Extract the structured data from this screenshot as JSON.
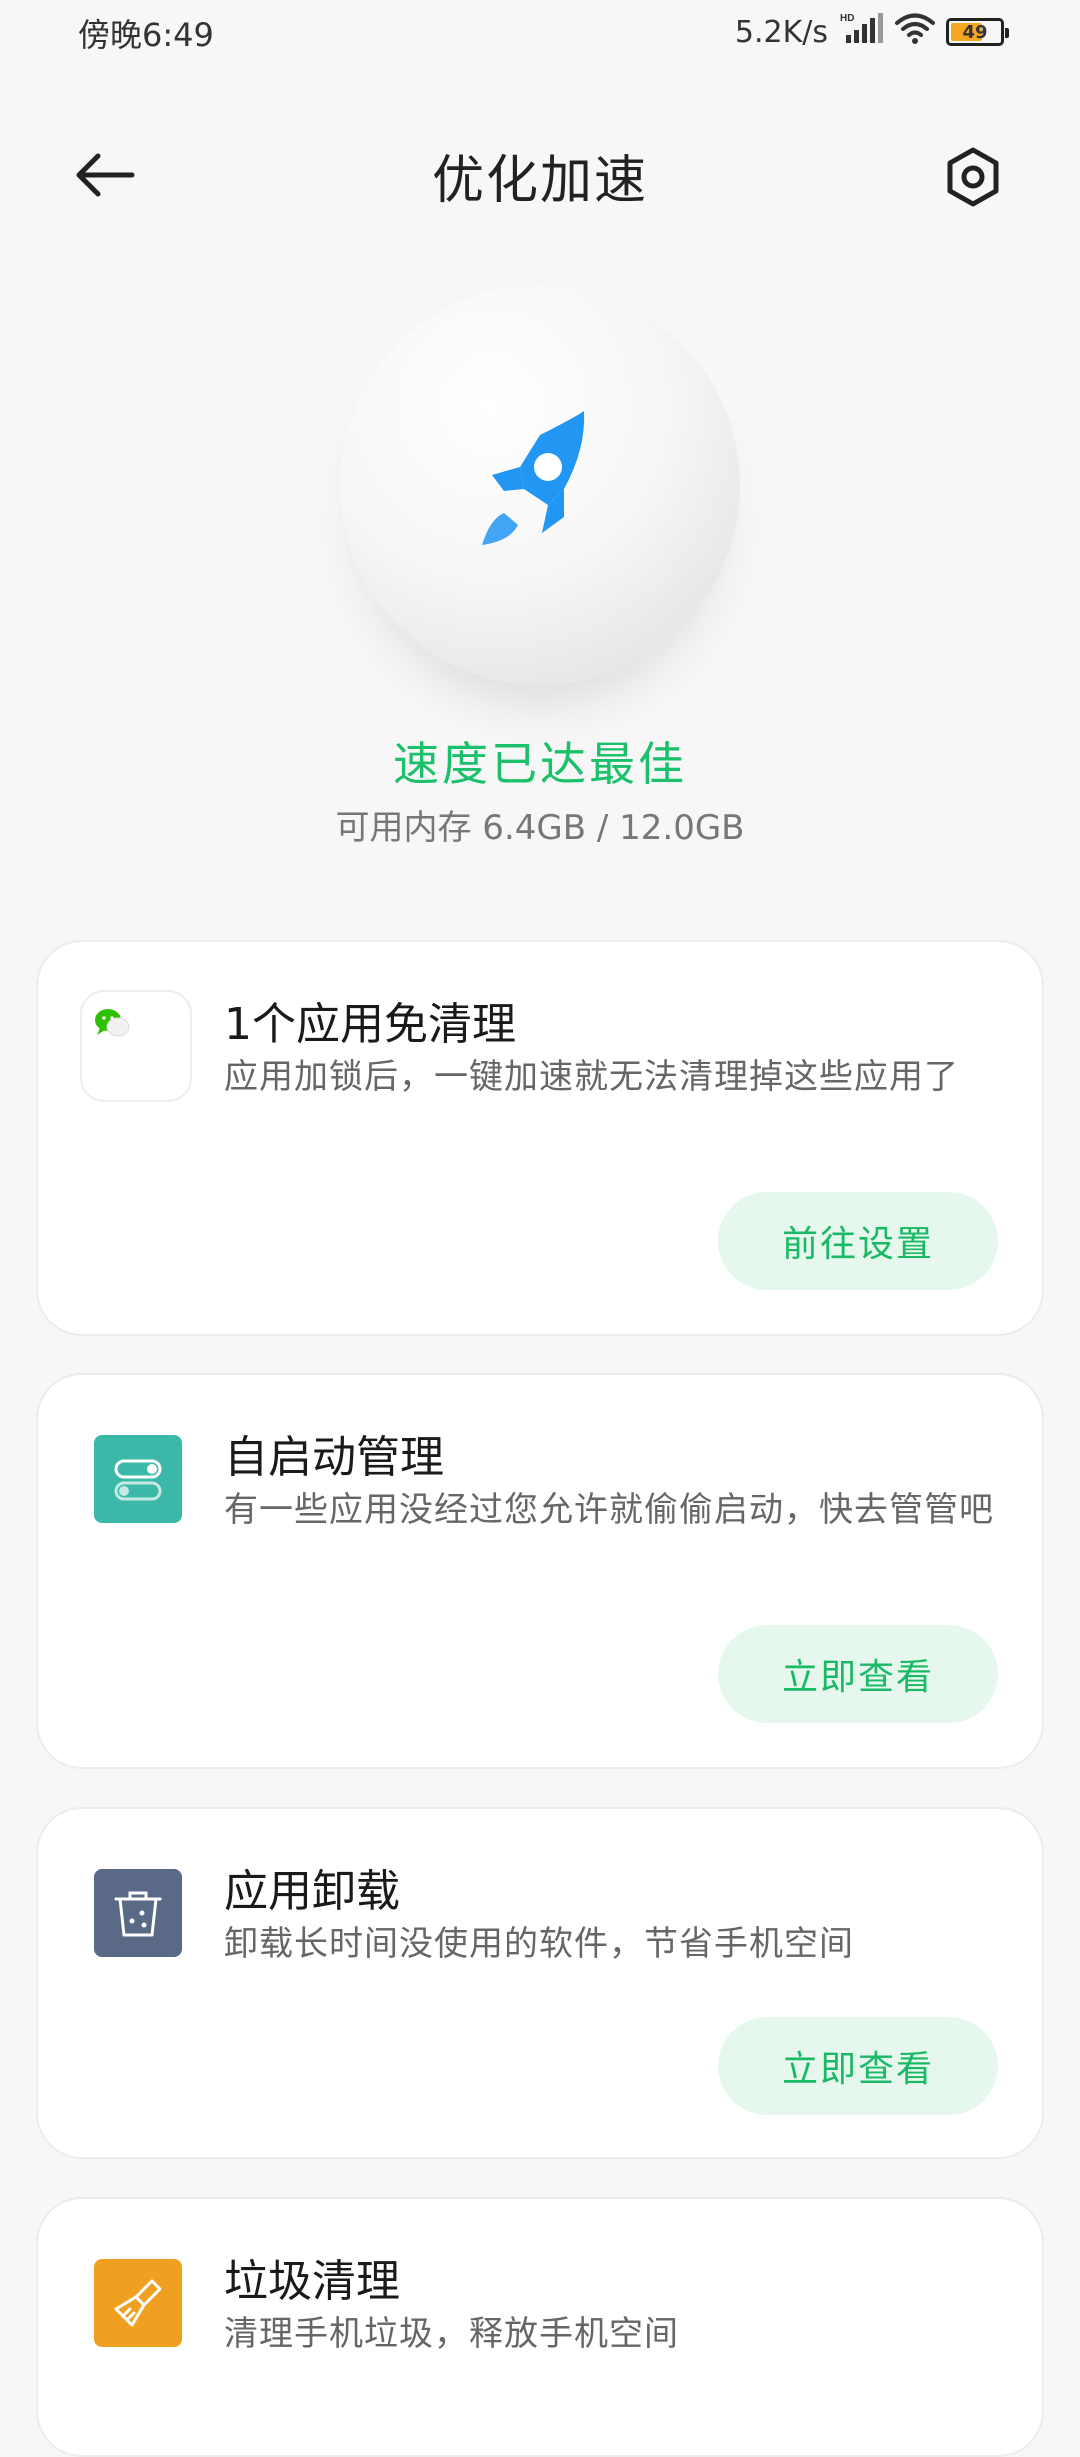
{
  "status_bar": {
    "time": "傍晚6:49",
    "net_speed": "5.2K/s",
    "battery_level": "49"
  },
  "header": {
    "title": "优化加速"
  },
  "hero": {
    "status": "速度已达最佳",
    "memory": "可用内存 6.4GB / 12.0GB"
  },
  "cards": [
    {
      "title": "1个应用免清理",
      "desc": "应用加锁后，一键加速就无法清理掉这些应用了",
      "button": "前往设置",
      "icon": "wechat-icon"
    },
    {
      "title": "自启动管理",
      "desc": "有一些应用没经过您允许就偷偷启动，快去管管吧",
      "button": "立即查看",
      "icon": "toggle-switch-icon"
    },
    {
      "title": "应用卸载",
      "desc": "卸载长时间没使用的软件，节省手机空间",
      "button": "立即查看",
      "icon": "uninstall-trash-icon"
    },
    {
      "title": "垃圾清理",
      "desc": "清理手机垃圾，释放手机空间",
      "icon": "broom-icon"
    }
  ],
  "colors": {
    "accent_green": "#1ac06a",
    "button_bg": "#e6f8ee",
    "rocket_blue": "#2196f3",
    "autostart_teal": "#3cb8a8",
    "uninstall_slate": "#5a6a86",
    "cleanup_orange": "#f0a020"
  }
}
